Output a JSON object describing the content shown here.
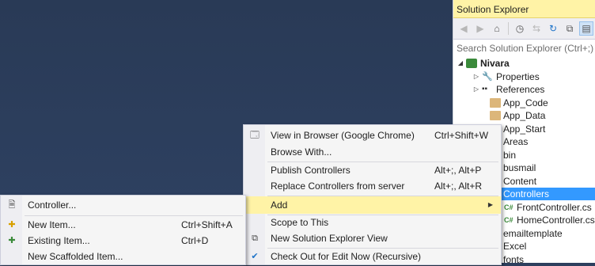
{
  "solution_explorer": {
    "title": "Solution Explorer",
    "search_placeholder": "Search Solution Explorer (Ctrl+;)",
    "tree": [
      {
        "label": "Nivara",
        "bold": true
      },
      {
        "label": "Properties"
      },
      {
        "label": "References"
      },
      {
        "label": "App_Code"
      },
      {
        "label": "App_Data"
      },
      {
        "label": "App_Start"
      },
      {
        "label": "Areas"
      },
      {
        "label": "bin"
      },
      {
        "label": "busmail"
      },
      {
        "label": "Content"
      },
      {
        "label": "Controllers",
        "selected": true
      },
      {
        "label": "FrontController.cs"
      },
      {
        "label": "HomeController.cs"
      },
      {
        "label": "emailtemplate"
      },
      {
        "label": "Excel"
      },
      {
        "label": "fonts"
      }
    ]
  },
  "context_menu": {
    "items": [
      {
        "label": "View in Browser (Google Chrome)",
        "shortcut": "Ctrl+Shift+W"
      },
      {
        "label": "Browse With...",
        "shortcut": ""
      },
      {
        "label": "Publish Controllers",
        "shortcut": "Alt+;, Alt+P"
      },
      {
        "label": "Replace Controllers from server",
        "shortcut": "Alt+;, Alt+R"
      },
      {
        "label": "Add",
        "shortcut": ""
      },
      {
        "label": "Scope to This",
        "shortcut": ""
      },
      {
        "label": "New Solution Explorer View",
        "shortcut": ""
      },
      {
        "label": "Check Out for Edit Now (Recursive)",
        "shortcut": ""
      }
    ]
  },
  "add_submenu": {
    "items": [
      {
        "label": "Controller...",
        "shortcut": ""
      },
      {
        "label": "New Item...",
        "shortcut": "Ctrl+Shift+A"
      },
      {
        "label": "Existing Item...",
        "shortcut": "Ctrl+D"
      },
      {
        "label": "New Scaffolded Item...",
        "shortcut": ""
      }
    ]
  }
}
